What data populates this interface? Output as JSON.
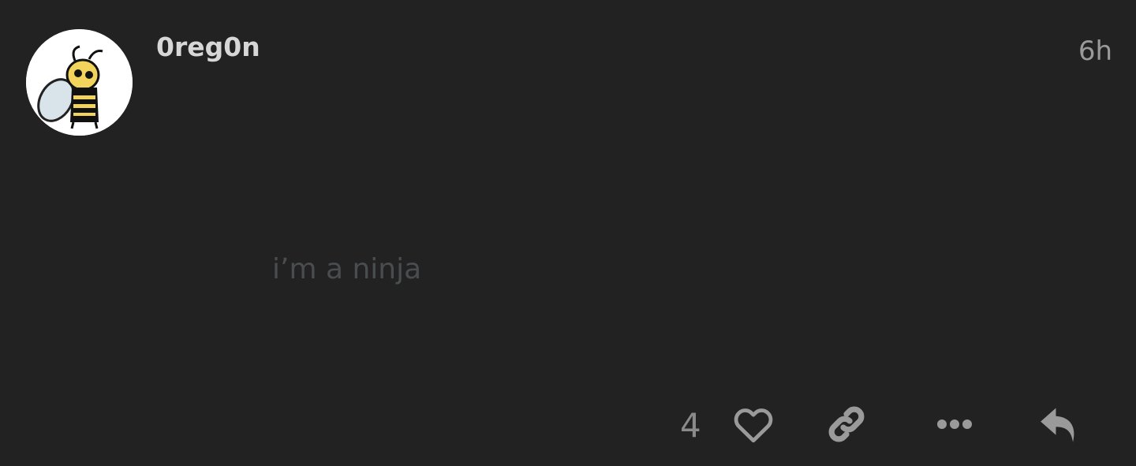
{
  "post": {
    "username": "0reg0n",
    "timestamp": "6h",
    "content": "i’m a ninja",
    "avatar_icon": "bee-skull-avatar",
    "actions": {
      "like_count": "4",
      "like_icon": "heart-outline-icon",
      "link_icon": "link-icon",
      "more_icon": "ellipsis-icon",
      "reply_icon": "reply-icon"
    }
  },
  "colors": {
    "background": "#222222",
    "username": "#d7d7d7",
    "timestamp": "#9a9a9a",
    "content": "#4a4d4f",
    "icons": "#9a9a9a",
    "avatar_bg": "#ffffff",
    "bee_yellow": "#f2d35b"
  }
}
